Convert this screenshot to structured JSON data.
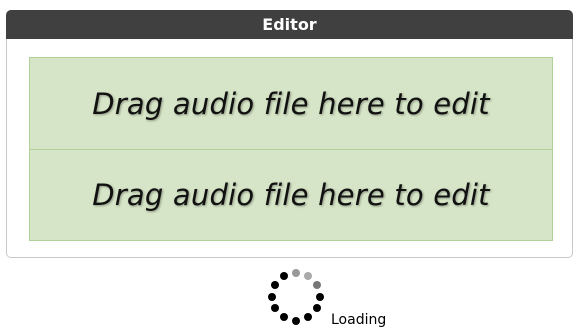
{
  "editor": {
    "title": "Editor",
    "dropzones": [
      {
        "label": "Drag audio file here to edit"
      },
      {
        "label": "Drag audio file here to edit"
      }
    ]
  },
  "status": {
    "loading_text": "Loading",
    "spinner_icon": "spinner-icon"
  },
  "colors": {
    "header_bg": "#404040",
    "dropzone_bg": "#d6e5c7",
    "dropzone_border": "#b2d199"
  }
}
